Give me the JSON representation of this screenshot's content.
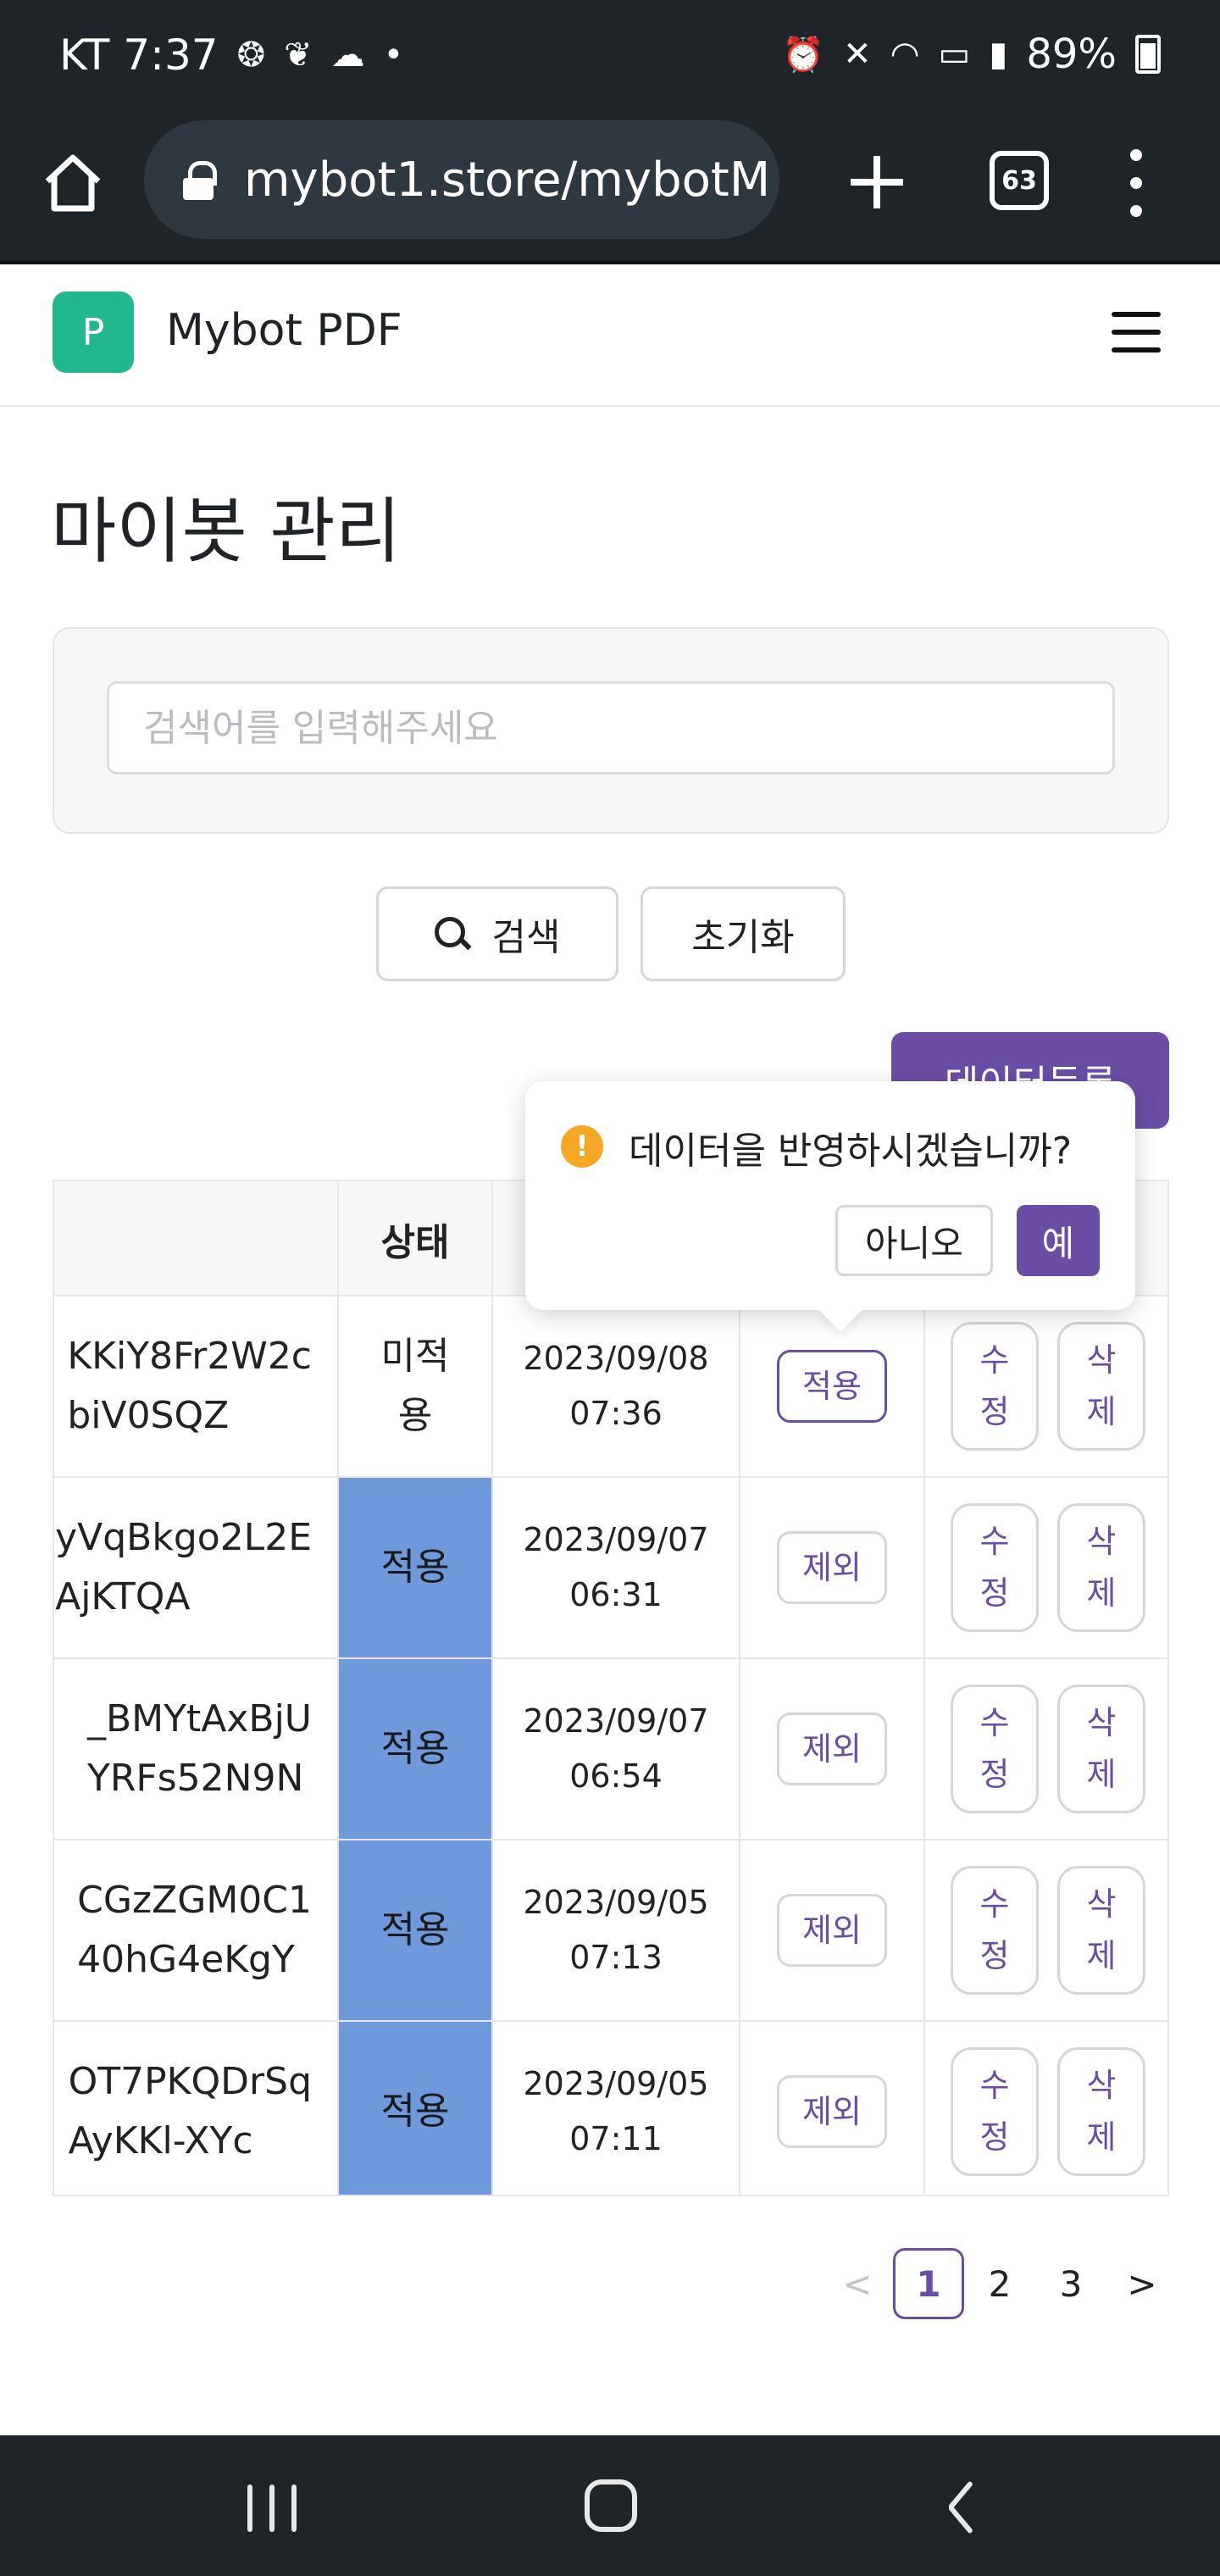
{
  "status_bar": {
    "carrier_time": "KT 7:37",
    "battery": "89%"
  },
  "browser": {
    "url": "mybot1.store/mybotM",
    "tab_count": "63"
  },
  "app": {
    "logo_letter": "P",
    "name": "Mybot PDF"
  },
  "page": {
    "title": "마이봇 관리",
    "search_placeholder": "검색어를 입력해주세요",
    "search_button": "검색",
    "reset_button": "초기화",
    "register_button": "데이터등록"
  },
  "table": {
    "headers": [
      "",
      "상태",
      "",
      "",
      ""
    ],
    "rows": [
      {
        "id": "KKiY8Fr2W2c\nbiV0SQZ",
        "status": "미적\n용",
        "status_on": false,
        "date": "2023/09/08\n07:36",
        "toggle": "적용",
        "edit": "수\n정",
        "delete": "삭\n제"
      },
      {
        "id": "yVqBkgo2L2E\nAjKTQA",
        "status": "적용",
        "status_on": true,
        "date": "2023/09/07\n06:31",
        "toggle": "제외",
        "edit": "수\n정",
        "delete": "삭\n제"
      },
      {
        "id": "BMYtAxBjU_\nYRFs52N9N",
        "status": "적용",
        "status_on": true,
        "date": "2023/09/07\n06:54",
        "toggle": "제외",
        "edit": "수\n정",
        "delete": "삭\n제"
      },
      {
        "id": "CGzZGM0C1\n40hG4eKgY",
        "status": "적용",
        "status_on": true,
        "date": "2023/09/05\n07:13",
        "toggle": "제외",
        "edit": "수\n정",
        "delete": "삭\n제"
      },
      {
        "id": "OT7PKQDrSq\nAyKKl-XYc",
        "status": "적용",
        "status_on": true,
        "date": "2023/09/05\n07:11",
        "toggle": "제외",
        "edit": "수\n정",
        "delete": "삭\n제"
      }
    ]
  },
  "popconfirm": {
    "message": "데이터을 반영하시겠습니까?",
    "no": "아니오",
    "yes": "예"
  },
  "pagination": {
    "prev": "<",
    "pages": [
      "1",
      "2",
      "3"
    ],
    "current": "1",
    "next": ">"
  }
}
